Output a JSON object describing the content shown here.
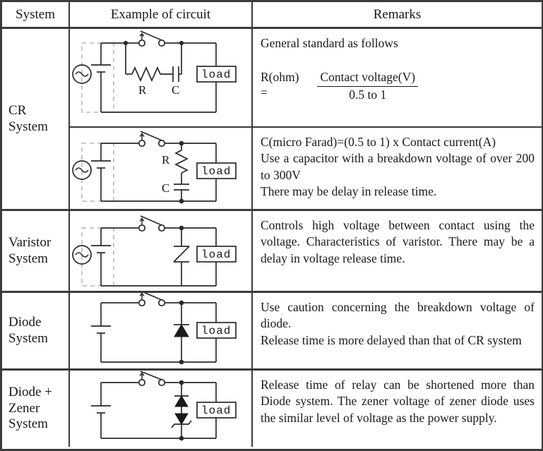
{
  "header": {
    "system": "System",
    "circuit": "Example of circuit",
    "remarks": "Remarks"
  },
  "rows": [
    {
      "system": "CR\nSystem",
      "system_line1": "CR",
      "system_line2": "System",
      "circuits": [
        {
          "name": "cr-series-rc",
          "labels": {
            "r": "R",
            "c": "C",
            "load": "load"
          },
          "has_ac_source": true,
          "has_battery": true,
          "has_switch": true
        },
        {
          "name": "cr-parallel-rc",
          "labels": {
            "r": "R",
            "c": "C",
            "load": "load"
          },
          "has_ac_source": true,
          "has_battery": true,
          "has_switch": true
        }
      ],
      "remarks": [
        {
          "kind": "text",
          "value": "General standard as follows"
        },
        {
          "kind": "formula",
          "lhs_line1": "R(ohm)",
          "lhs_line2": "=",
          "numerator": "Contact voltage(V)",
          "denominator": "0.5 to 1"
        },
        {
          "kind": "text",
          "value": "C(micro Farad)=(0.5 to 1) x Contact current(A)\nUse a capacitor with a breakdown voltage of over 200 to 300V\nThere may be delay in release time."
        }
      ],
      "remarks_block_1": "General standard as follows",
      "remarks_block_2_line1": "C(micro Farad)=(0.5 to 1) x Contact current(A)",
      "remarks_block_2_line2": "Use a capacitor with a breakdown voltage of over 200 to 300V",
      "remarks_block_2_line3": "There may be delay in release time."
    },
    {
      "system_line1": "Varistor",
      "system_line2": "System",
      "circuit": {
        "name": "varistor-circuit",
        "labels": {
          "load": "load"
        },
        "has_ac_source": true,
        "has_battery": true,
        "has_switch": true
      },
      "remarks": "Controls high voltage between contact using the voltage. Characteristics of varistor. There may be a delay in voltage release time."
    },
    {
      "system_line1": "Diode",
      "system_line2": "System",
      "circuit": {
        "name": "diode-circuit",
        "labels": {
          "load": "load"
        },
        "has_ac_source": false,
        "has_battery": true,
        "has_switch": true
      },
      "remarks_line1": "Use caution concerning the breakdown voltage of diode.",
      "remarks_line2": "Release time is more delayed than that of CR system"
    },
    {
      "system_line1": "Diode +",
      "system_line2": "Zener",
      "system_line3": "System",
      "circuit": {
        "name": "diode-zener-circuit",
        "labels": {
          "load": "load"
        },
        "has_ac_source": false,
        "has_battery": true,
        "has_switch": true
      },
      "remarks": "Release time of relay can be shortened more than Diode system. The zener voltage of zener diode uses the similar level of voltage as the power supply."
    }
  ],
  "colors": {
    "border": "#3b3b3b",
    "wire": "#2a2a2a",
    "dashed_box": "#b8b8b8",
    "text": "#1a1a1a",
    "background": "#ffffff"
  }
}
